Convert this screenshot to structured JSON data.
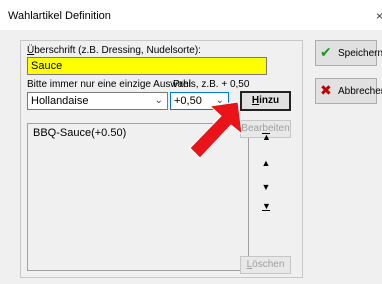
{
  "window": {
    "title": "Wahlartikel Definition",
    "close_glyph": "×"
  },
  "form": {
    "heading_label_first": "Ü",
    "heading_label_rest": "berschrift (z.B. Dressing, Nudelsorte):",
    "heading_value": "Sauce",
    "choice_label": "Bitte immer nur eine einzige Auswahl",
    "choice_value": "Hollandaise",
    "price_label": "Preis, z.B. + 0,50",
    "price_value": "+0,50"
  },
  "buttons": {
    "add_first": "H",
    "add_rest": "inzu",
    "edit": "Bearbeiten",
    "delete_first": "L",
    "delete_rest": "öschen",
    "save": "Speichern",
    "cancel": "Abbrechen"
  },
  "list": {
    "items": [
      "BBQ-Sauce(+0.50)"
    ]
  },
  "order_controls": {
    "top": "▲",
    "up": "▲",
    "down": "▼",
    "bottom": "▼"
  },
  "icons": {
    "save_check": "✔",
    "cancel_x": "✖",
    "save_color": "#1a9a1a",
    "cancel_color": "#c00000",
    "callout_arrow_color": "#e8141a"
  }
}
